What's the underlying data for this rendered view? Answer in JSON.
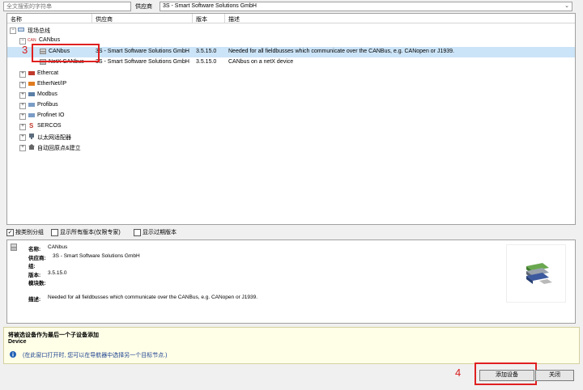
{
  "search": {
    "placeholder": "全文搜索的字符串"
  },
  "vendor": {
    "label": "供应商",
    "selected": "3S - Smart Software Solutions GmbH"
  },
  "columns": {
    "name": "名称",
    "vendor": "供应商",
    "version": "版本",
    "description": "描述"
  },
  "tree": {
    "root": "现场总线",
    "canbus_group": "CANbus",
    "canbus_group_tag": "CAN",
    "selected_item": {
      "name": "CANbus",
      "vendor": "3S - Smart Software Solutions GmbH",
      "version": "3.5.15.0",
      "description": "Needed for all fieldbusses which communicate over the CANBus, e.g. CANopen or J1939."
    },
    "netx_item": {
      "name": "NetX CANbus",
      "vendor": "3S - Smart Software Solutions GmbH",
      "version": "3.5.15.0",
      "description": "CANbus on a netX device"
    },
    "others": [
      "Ethercat",
      "EtherNet/IP",
      "Modbus",
      "Profibus",
      "Profinet IO",
      "SERCOS",
      "以太网适配器",
      "自动回原点&建立"
    ],
    "sercos_glyph": "S"
  },
  "annotations": {
    "step3": "3",
    "step4": "4"
  },
  "options": {
    "group_by_category": "按类别分组",
    "show_all_versions": "显示所有版本(仅限专家)",
    "show_outdated": "显示过期版本"
  },
  "details": {
    "name_label": "名称:",
    "name_value": "CANbus",
    "vendor_label": "供应商:",
    "vendor_value": "3S - Smart Software Solutions GmbH",
    "group_label": "组:",
    "version_label": "版本:",
    "version_value": "3.5.15.0",
    "model_label": "模块数:",
    "desc_label": "描述:",
    "desc_value": "Needed for all fieldbusses which communicate over the CANBus, e.g. CANopen or J1939."
  },
  "message": {
    "title": "将被选设备作为最后一个子设备添加",
    "subtitle": "Device",
    "info": "(在此窗口打开时, 您可以在导航器中选择另一个目标节点.)"
  },
  "buttons": {
    "add": "添加设备",
    "close": "关闭"
  }
}
